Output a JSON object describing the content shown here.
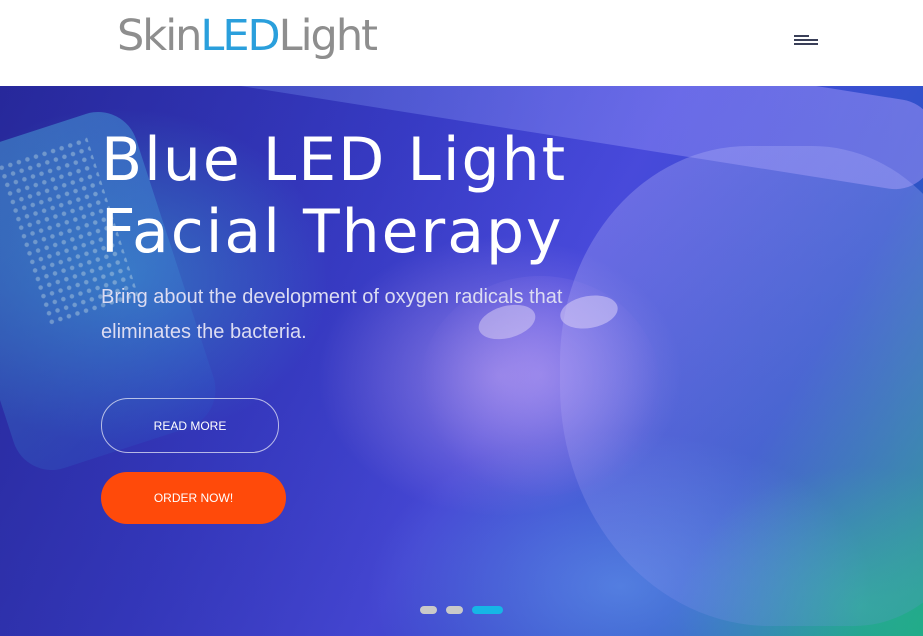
{
  "header": {
    "logo": {
      "part1": "Skin",
      "part2": "LED",
      "part3": "Light"
    },
    "menu_icon": "hamburger-menu-icon"
  },
  "hero": {
    "title_line1": "Blue LED Light",
    "title_line2": "Facial Therapy",
    "subtitle": "Bring about the development of oxygen radicals that eliminates the bacteria.",
    "read_more_label": "READ MORE",
    "order_now_label": "ORDER NOW!",
    "slider": {
      "total_slides": 3,
      "active_slide": 3
    }
  },
  "colors": {
    "logo_gray": "#8e8e8e",
    "logo_blue": "#2a9fdc",
    "order_button": "#ff4a0a",
    "active_dot": "#16b6e6",
    "inactive_dot": "#c9c9c9"
  }
}
